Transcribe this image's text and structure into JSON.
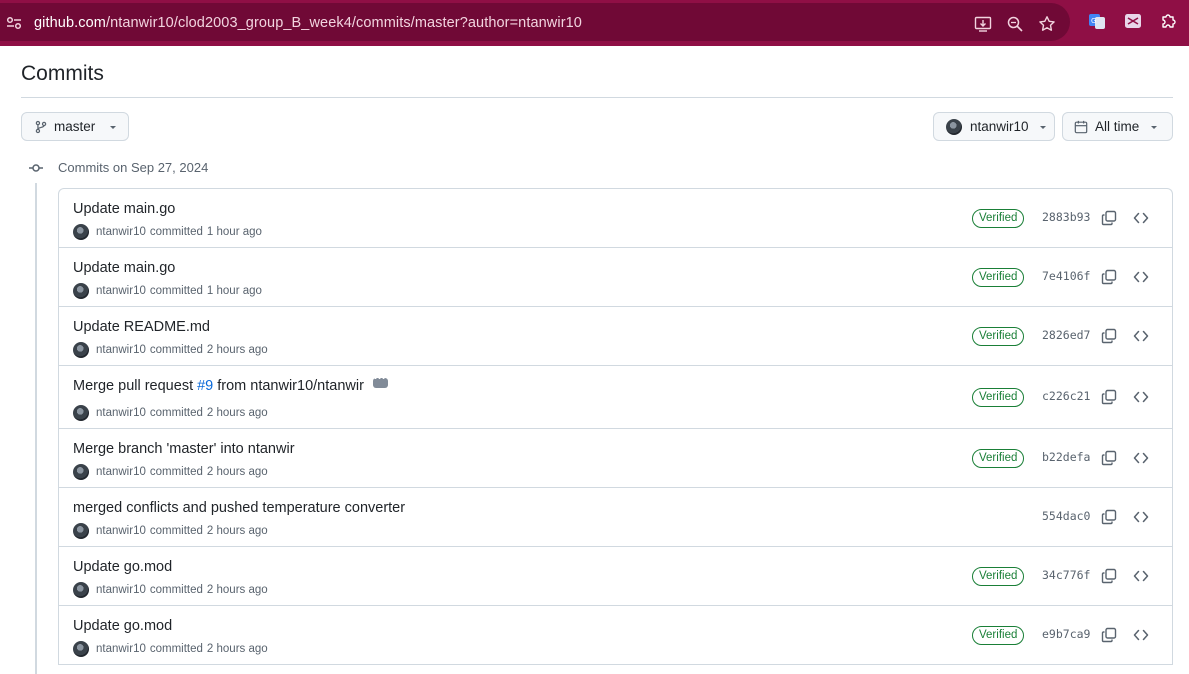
{
  "browser": {
    "url_host": "github.com",
    "url_path": "/ntanwir10/clod2003_group_B_week4/commits/master?author=ntanwir10"
  },
  "page": {
    "title": "Commits",
    "branch_label": "master",
    "author_label": "ntanwir10",
    "time_label": "All time",
    "day_label": "Commits on Sep 27, 2024"
  },
  "commits": [
    {
      "title": "Update main.go",
      "author": "ntanwir10",
      "action": "committed",
      "time": "1 hour ago",
      "verified": "Verified",
      "sha": "2883b93"
    },
    {
      "title": "Update main.go",
      "author": "ntanwir10",
      "action": "committed",
      "time": "1 hour ago",
      "verified": "Verified",
      "sha": "7e4106f"
    },
    {
      "title": "Update README.md",
      "author": "ntanwir10",
      "action": "committed",
      "time": "2 hours ago",
      "verified": "Verified",
      "sha": "2826ed7"
    },
    {
      "title_prefix": "Merge pull request",
      "pr": "#9",
      "title_suffix": "from ntanwir10/ntanwir",
      "author": "ntanwir10",
      "action": "committed",
      "time": "2 hours ago",
      "verified": "Verified",
      "sha": "c226c21"
    },
    {
      "title": "Merge branch 'master' into ntanwir",
      "author": "ntanwir10",
      "action": "committed",
      "time": "2 hours ago",
      "verified": "Verified",
      "sha": "b22defa"
    },
    {
      "title": "merged conflicts and pushed temperature converter",
      "author": "ntanwir10",
      "action": "committed",
      "time": "2 hours ago",
      "sha": "554dac0"
    },
    {
      "title": "Update go.mod",
      "author": "ntanwir10",
      "action": "committed",
      "time": "2 hours ago",
      "verified": "Verified",
      "sha": "34c776f"
    },
    {
      "title": "Update go.mod",
      "author": "ntanwir10",
      "action": "committed",
      "time": "2 hours ago",
      "verified": "Verified",
      "sha": "e9b7ca9"
    }
  ],
  "colors": {
    "browser_bar": "#8f0f45",
    "verified": "#1a7f37",
    "link": "#0969da"
  }
}
